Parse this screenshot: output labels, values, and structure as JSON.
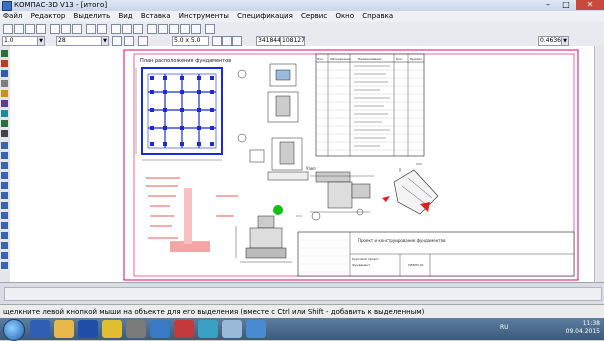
{
  "window": {
    "title": "КОМПАС-3D V13 - [итого]",
    "buttons": {
      "minimize": "–",
      "maximize": "□",
      "close": "✕"
    }
  },
  "menu": {
    "items": [
      "Файл",
      "Редактор",
      "Выделить",
      "Вид",
      "Вставка",
      "Инструменты",
      "Спецификация",
      "Сервис",
      "Окно",
      "Справка"
    ]
  },
  "toolbar": {
    "line_scale": "1.0",
    "layer_number": "28",
    "grid_step": "5.0 x 5.0",
    "scale_value": "0.4636",
    "coord_x": "341844",
    "coord_y": "108127"
  },
  "drawing": {
    "plan_title": "План          расположения                    фундаментов",
    "section_label": "Узел",
    "spec_header": [
      "Поз.",
      "Обозначение",
      "Наименование",
      "Кол.",
      "Примеч."
    ],
    "title_block": {
      "main": "Проект и конструирование фундаментов",
      "sub1": "Курсовой проект",
      "sub2": "Фундамент",
      "sheet": "ТИФП3-01"
    }
  },
  "status": {
    "hint": "щелкните левой кнопкой мыши на объекте для его выделения (вместе с Ctrl или Shift - добавить к выделенным)"
  },
  "taskbar": {
    "lang": "RU",
    "time": "11:38",
    "date": "09.04.2015"
  },
  "colors": {
    "frame": "#e0006e",
    "blue_plan": "#1a2bd6",
    "red": "#e02020",
    "green": "#00a000"
  }
}
